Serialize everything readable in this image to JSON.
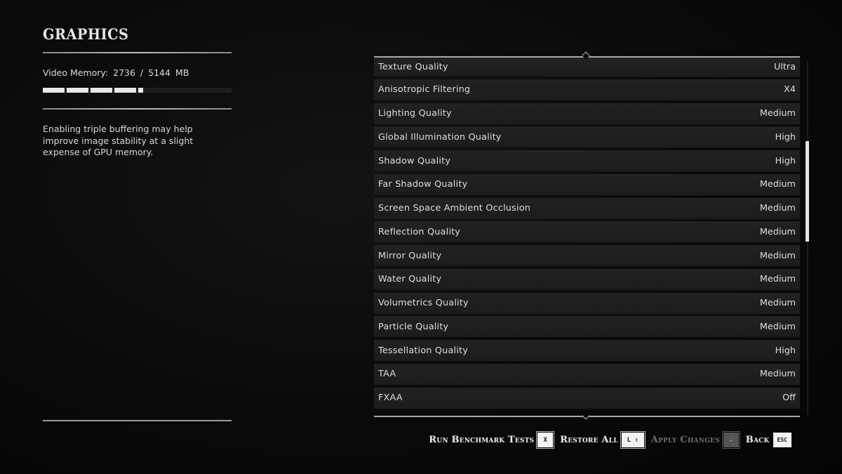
{
  "panel": {
    "title": "GRAPHICS",
    "video_memory": {
      "label": "Video Memory:",
      "used": "2736",
      "separator": "/",
      "total": "5144",
      "unit": "MB",
      "used_fraction": 0.532
    },
    "description": "Enabling triple buffering may help improve image stability at a slight expense of GPU memory."
  },
  "settings": [
    {
      "label": "Texture Quality",
      "value": "Ultra"
    },
    {
      "label": "Anisotropic Filtering",
      "value": "X4"
    },
    {
      "label": "Lighting Quality",
      "value": "Medium"
    },
    {
      "label": "Global Illumination Quality",
      "value": "High"
    },
    {
      "label": "Shadow Quality",
      "value": "High"
    },
    {
      "label": "Far Shadow Quality",
      "value": "Medium"
    },
    {
      "label": "Screen Space Ambient Occlusion",
      "value": "Medium"
    },
    {
      "label": "Reflection Quality",
      "value": "Medium"
    },
    {
      "label": "Mirror Quality",
      "value": "Medium"
    },
    {
      "label": "Water Quality",
      "value": "Medium"
    },
    {
      "label": "Volumetrics Quality",
      "value": "Medium"
    },
    {
      "label": "Particle Quality",
      "value": "Medium"
    },
    {
      "label": "Tessellation Quality",
      "value": "High"
    },
    {
      "label": "TAA",
      "value": "Medium"
    },
    {
      "label": "FXAA",
      "value": "Off"
    }
  ],
  "footer": {
    "run_benchmark": {
      "label": "Run Benchmark Tests",
      "key": "X"
    },
    "restore_all": {
      "label": "Restore All",
      "key": "L ⇧"
    },
    "apply_changes": {
      "label": "Apply Changes",
      "key": "↵",
      "enabled": false
    },
    "back": {
      "label": "Back",
      "key": "ESC"
    }
  }
}
